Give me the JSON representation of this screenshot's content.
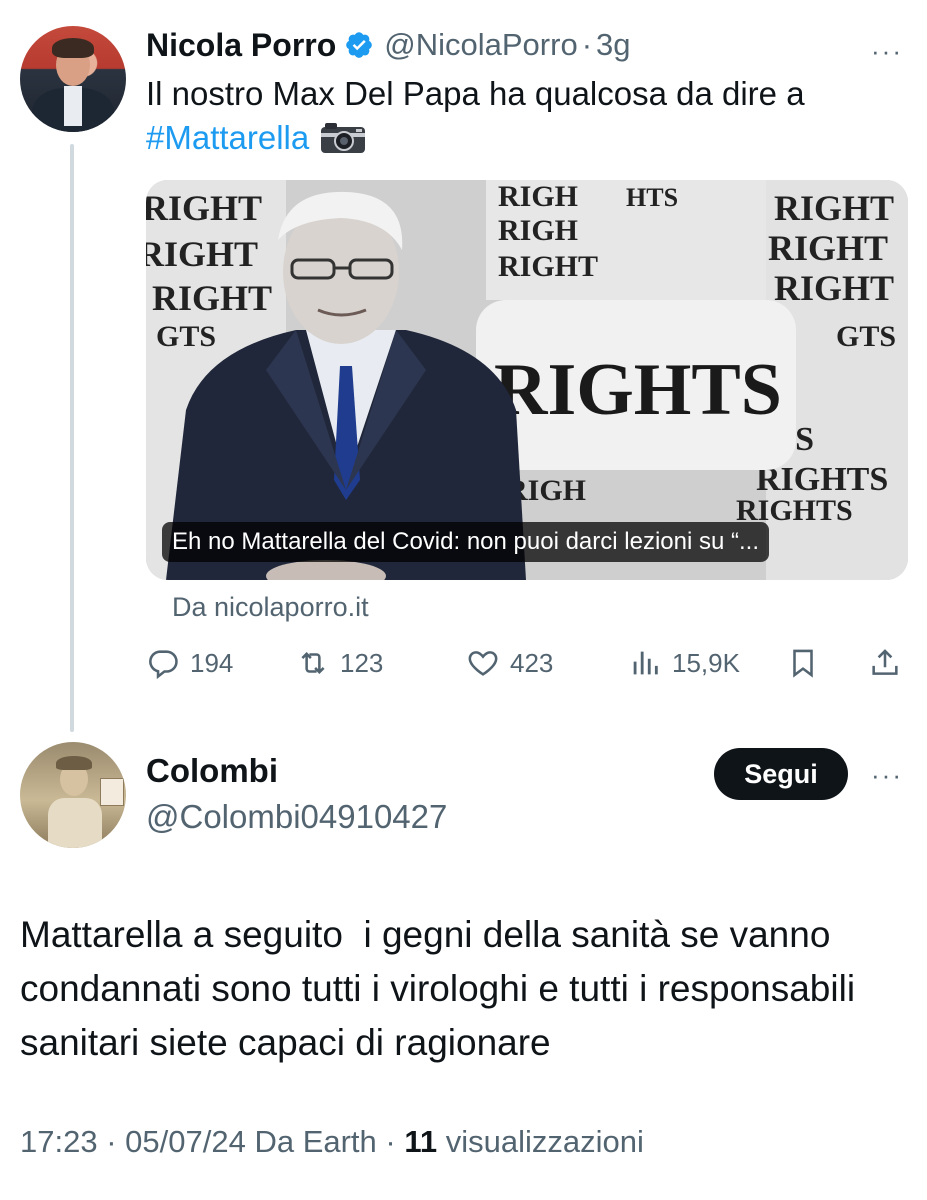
{
  "quoted_tweet": {
    "author_name": "Nicola Porro",
    "handle": "@NicolaPorro",
    "separator": "·",
    "time": "3g",
    "more": "···",
    "text_before": "Il nostro Max Del Papa ha qualcosa da dire a ",
    "hashtag": "#Mattarella",
    "card": {
      "headline": "Eh no Mattarella del Covid: non puoi darci lezioni su “...",
      "source": "Da nicolaporro.it",
      "image_words": [
        "RIGHTS",
        "RIGHT",
        "RIGH",
        "HTS",
        "GTS"
      ]
    },
    "actions": {
      "replies": "194",
      "retweets": "123",
      "likes": "423",
      "views": "15,9K"
    },
    "icons": [
      "verified-badge-icon",
      "camera-icon",
      "reply-icon",
      "retweet-icon",
      "like-icon",
      "views-icon",
      "bookmark-icon",
      "share-icon"
    ]
  },
  "main_tweet": {
    "author_name": "Colombi",
    "handle": "@Colombi04910427",
    "follow_label": "Segui",
    "more": "···",
    "text": "Mattarella a seguito  i gegni della sanità se vanno condannati sono tutti i virologhi e tutti i responsabili sanitari siete capaci di ragionare",
    "time": "17:23",
    "date": "05/07/24",
    "source": "Da Earth",
    "separator": "·",
    "views_count": "11",
    "views_label": "visualizzazioni"
  },
  "colors": {
    "accent": "#1d9bf0",
    "text": "#0f1419",
    "muted": "#536471",
    "thread_line": "#cfd9de"
  }
}
